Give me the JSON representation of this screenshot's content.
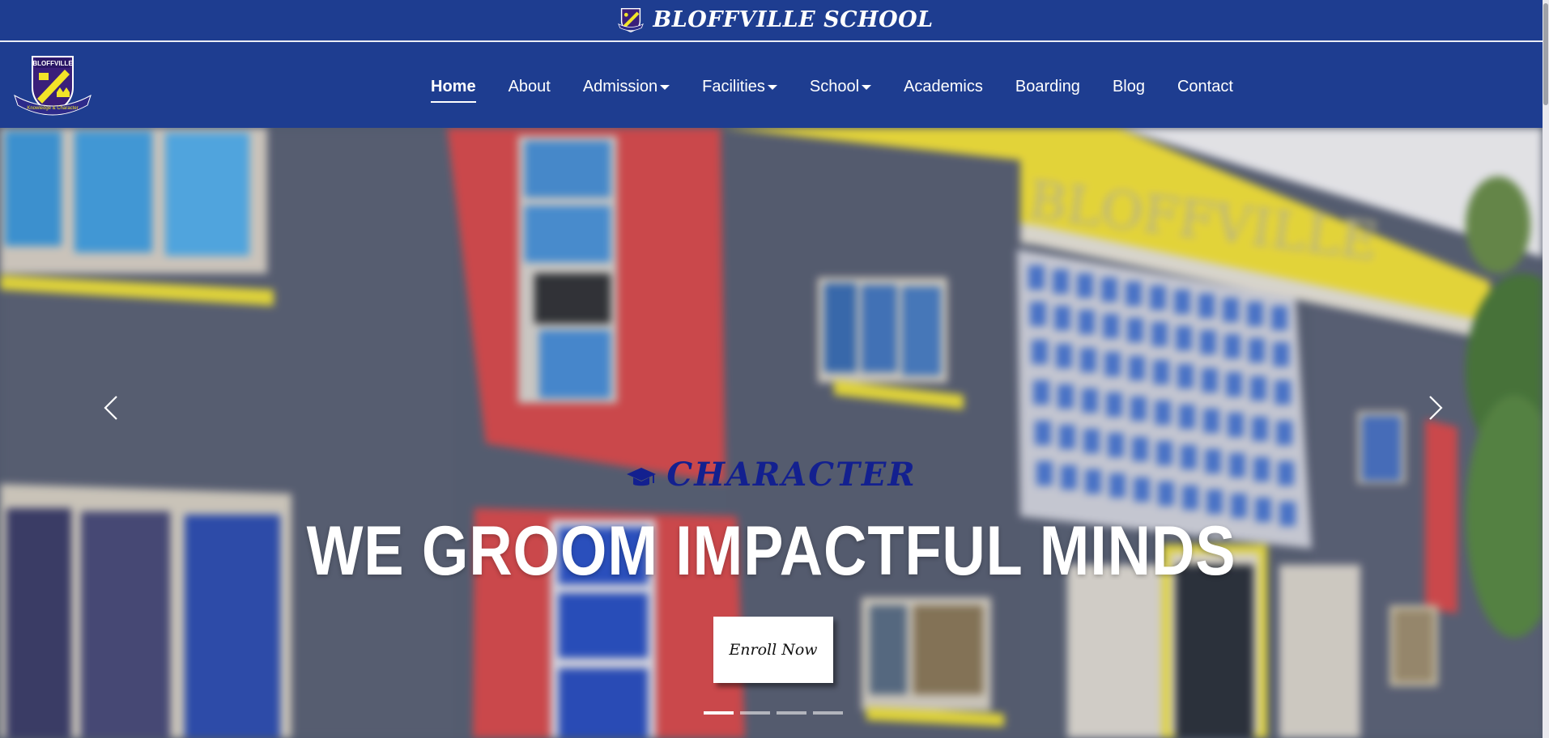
{
  "brand": {
    "school_name": "BLOFFVILLE SCHOOL",
    "logo_text_top": "BLOFFVILLE",
    "logo_motto": "Knowledge & Character"
  },
  "nav": {
    "items": [
      {
        "label": "Home",
        "dropdown": false,
        "active": true
      },
      {
        "label": "About",
        "dropdown": false,
        "active": false
      },
      {
        "label": "Admission",
        "dropdown": true,
        "active": false
      },
      {
        "label": "Facilities",
        "dropdown": true,
        "active": false
      },
      {
        "label": "School",
        "dropdown": true,
        "active": false
      },
      {
        "label": "Academics",
        "dropdown": false,
        "active": false
      },
      {
        "label": "Boarding",
        "dropdown": false,
        "active": false
      },
      {
        "label": "Blog",
        "dropdown": false,
        "active": false
      },
      {
        "label": "Contact",
        "dropdown": false,
        "active": false
      }
    ]
  },
  "hero": {
    "subtitle": "CHARACTER",
    "headline": "WE GROOM IMPACTFUL MINDS",
    "cta_label": "Enroll Now",
    "building_sign": "BLOFFVILLE",
    "slide_count": 4,
    "active_slide": 1,
    "icons": {
      "subtitle_icon": "graduation-cap-icon",
      "prev": "chevron-left-icon",
      "next": "chevron-right-icon"
    }
  },
  "colors": {
    "brand_blue": "#1e3d90",
    "subtitle_blue": "#13208f",
    "crest_yellow": "#f2e428",
    "crest_purple": "#3a1f7a"
  }
}
